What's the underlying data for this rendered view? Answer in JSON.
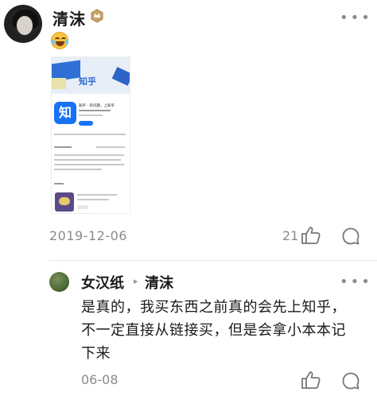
{
  "comment": {
    "author": "清沫",
    "badge_icon": "badge-icon",
    "emoji": "rofl-emoji",
    "date": "2019-12-06",
    "like_count": "21",
    "screenshot": {
      "brand": "知乎",
      "app_icon_char": "知",
      "app_title": "知乎 - 有问题，上知乎",
      "get_label": "获取"
    }
  },
  "reply": {
    "author": "女汉纸",
    "target": "清沫",
    "body": "是真的，我买东西之前真的会先上知乎，不一定直接从链接买，但是会拿小本本记下来",
    "date": "06-08"
  }
}
